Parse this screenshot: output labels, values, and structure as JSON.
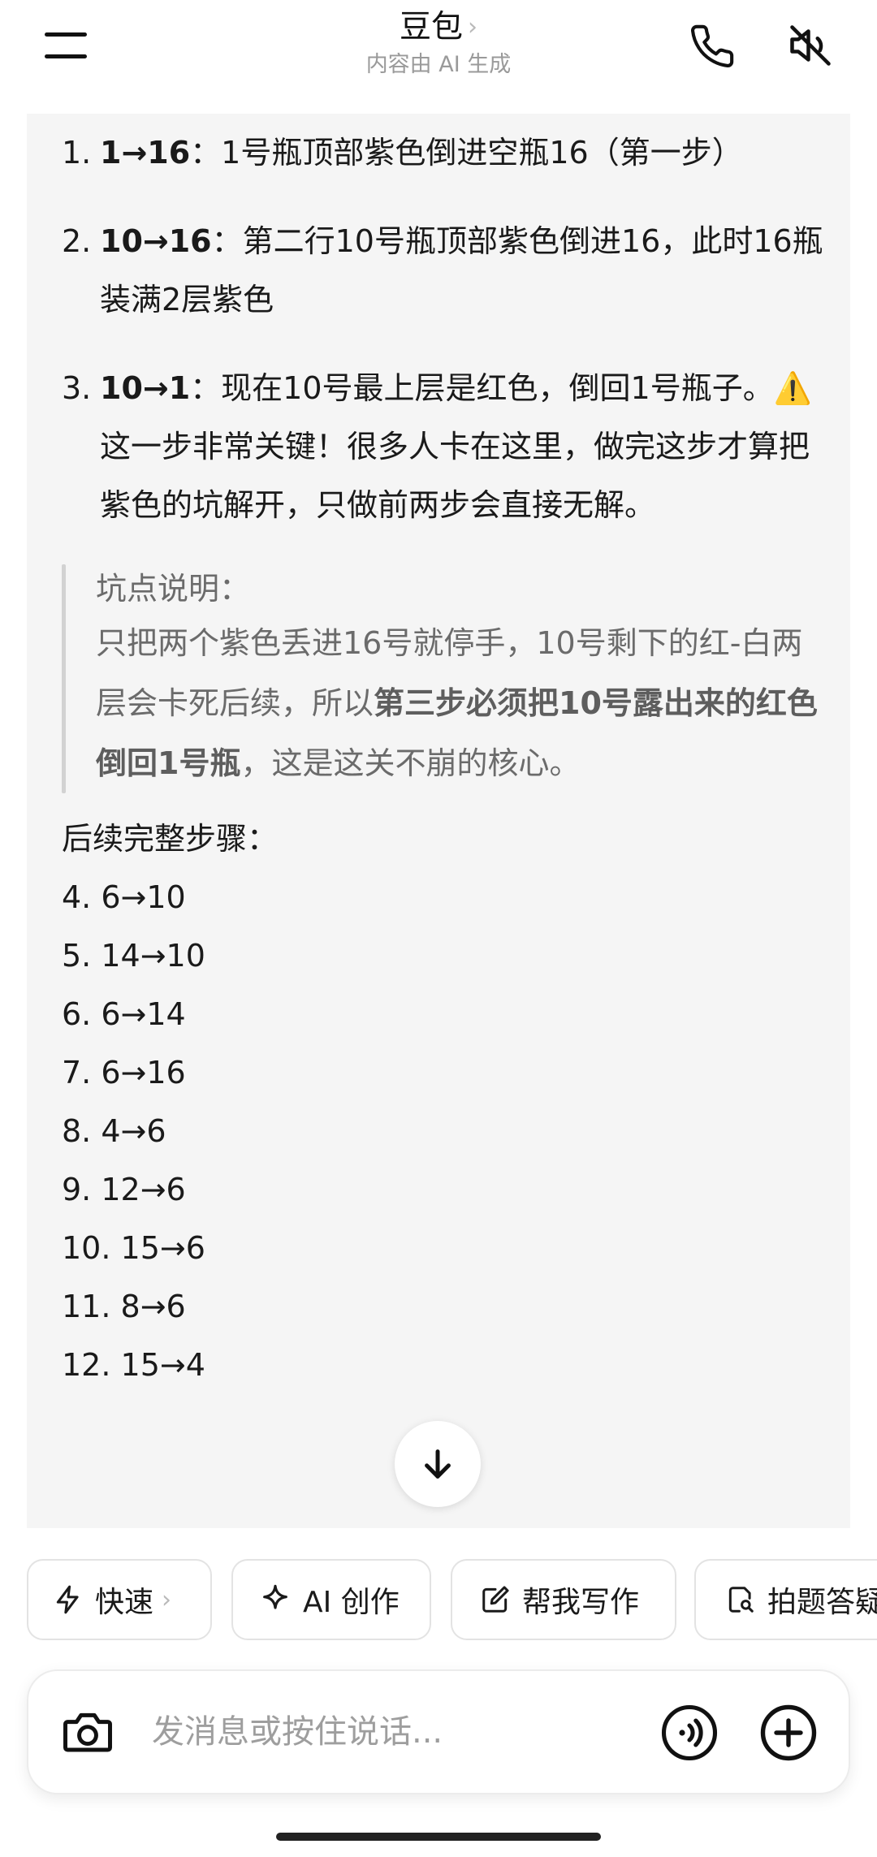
{
  "header": {
    "title": "豆包",
    "title_chevron": "›",
    "subtitle": "内容由 AI 生成",
    "icons": {
      "menu": "menu-icon",
      "call": "phone-icon",
      "mute": "speaker-muted-icon"
    }
  },
  "message": {
    "steps": [
      {
        "num": "1.",
        "bold": "1→16",
        "text": "：1号瓶顶部紫色倒进空瓶16（第一步）"
      },
      {
        "num": "2.",
        "bold": "10→16",
        "text": "：第二行10号瓶顶部紫色倒进16，此时16瓶装满2层紫色"
      },
      {
        "num": "3.",
        "bold": "10→1",
        "text": "：现在10号最上层是红色，倒回1号瓶子。",
        "warning_icon": "⚠️",
        "text_after": "这一步非常关键！很多人卡在这里，做完这步才算把紫色的坑解开，只做前两步会直接无解。"
      }
    ],
    "quote": {
      "title": "坑点说明：",
      "body_1": "只把两个紫色丢进16号就停手，10号剩下的红-白两层会卡死后续，所以",
      "body_bold": "第三步必须把10号露出来的红色倒回1号瓶",
      "body_2": "，这是这关不崩的核心。"
    },
    "follow_title": "后续完整步骤：",
    "follow_steps": [
      "4. 6→10",
      "5. 14→10",
      "6. 6→14",
      "7. 6→16",
      "8. 4→6",
      "9. 12→6",
      "10. 15→6",
      "11. 8→6",
      "12. 15→4"
    ]
  },
  "scroll_down_icon": "arrow-down-icon",
  "chips": {
    "fast": {
      "label": "快速",
      "chevron": "›",
      "icon": "lightning-icon"
    },
    "ai": {
      "label": "AI 创作",
      "icon": "sparkle-icon"
    },
    "write": {
      "label": "帮我写作",
      "icon": "edit-icon"
    },
    "photo": {
      "label": "拍题答疑",
      "icon": "doc-search-icon"
    }
  },
  "input": {
    "placeholder": "发消息或按住说话...",
    "value": "",
    "icons": {
      "camera": "camera-icon",
      "voice": "voice-call-icon",
      "plus": "plus-circle-icon"
    }
  },
  "colors": {
    "card_bg": "#f5f5f5",
    "text": "#1a1a1a",
    "muted": "#9a9a9a",
    "quote_bar": "#d2d2d2"
  }
}
